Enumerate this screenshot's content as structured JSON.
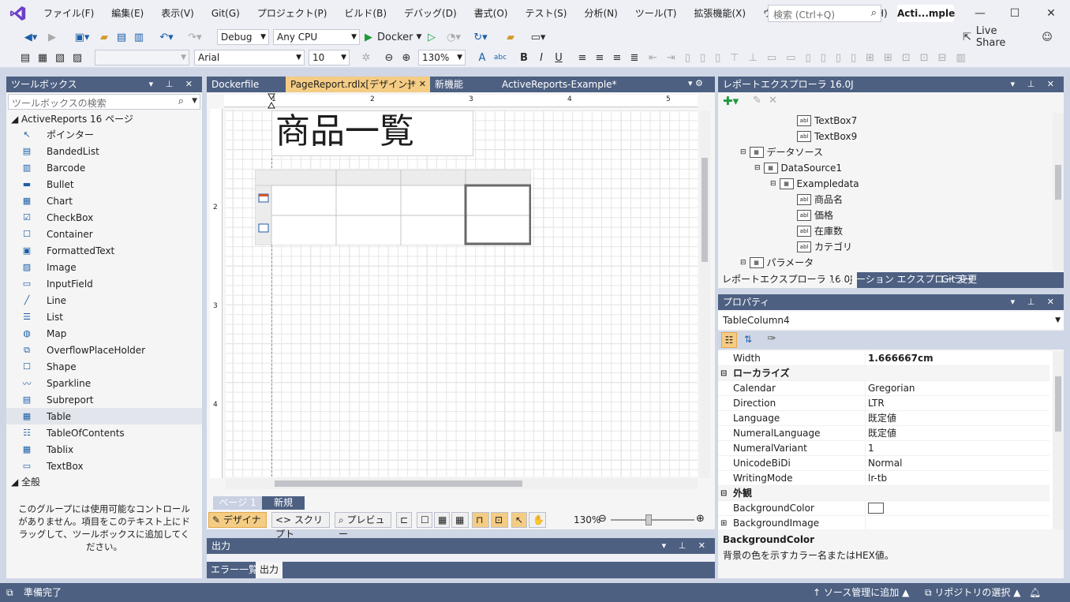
{
  "menu": {
    "items": [
      "ファイル(F)",
      "編集(E)",
      "表示(V)",
      "Git(G)",
      "プロジェクト(P)",
      "ビルド(B)",
      "デバッグ(D)",
      "書式(O)",
      "テスト(S)",
      "分析(N)",
      "ツール(T)",
      "拡張機能(X)",
      "ウィンドウ(W)",
      "ヘルプ(H)"
    ],
    "search_placeholder": "検索 (Ctrl+Q)",
    "solution_name": "Acti...mple"
  },
  "toolbar1": {
    "config": "Debug",
    "platform": "Any CPU",
    "run_label": "Docker",
    "live_share": "Live Share"
  },
  "toolbar2": {
    "style": "",
    "font": "Arial",
    "size": "10",
    "zoom": "130%"
  },
  "toolbox": {
    "title": "ツールボックス",
    "search_placeholder": "ツールボックスの検索",
    "group": "ActiveReports 16 ページ",
    "items": [
      "ポインター",
      "BandedList",
      "Barcode",
      "Bullet",
      "Chart",
      "CheckBox",
      "Container",
      "FormattedText",
      "Image",
      "InputField",
      "Line",
      "List",
      "Map",
      "OverflowPlaceHolder",
      "Shape",
      "Sparkline",
      "Subreport",
      "Table",
      "TableOfContents",
      "Tablix",
      "TextBox"
    ],
    "selected": "Table",
    "general_group": "全般",
    "empty_message": "このグループには使用可能なコントロールがありません。項目をこのテキスト上にドラッグして、ツールボックスに追加してください。"
  },
  "doc_tabs": [
    {
      "label": "Dockerfile",
      "active": false
    },
    {
      "label": "PageReport.rdlx[デザイン]*",
      "active": true
    },
    {
      "label": "新機能",
      "active": false
    },
    {
      "label": "ActiveReports-Example*",
      "active": false
    }
  ],
  "report": {
    "title_text": "商品一覧",
    "ruler_h": [
      "1",
      "2",
      "3",
      "4",
      "5"
    ],
    "ruler_v": [
      "2",
      "3",
      "4"
    ]
  },
  "page_tabs": {
    "page": "ページ 1",
    "new": "新規"
  },
  "designer_bar": {
    "designer": "デザイナ",
    "script": "スクリプト",
    "preview": "プレビュー",
    "zoom": "130%"
  },
  "output": {
    "title": "出力",
    "tab_errors": "エラー一覧",
    "tab_output": "出力"
  },
  "report_explorer": {
    "title": "レポートエクスプローラ 16.0J",
    "items": [
      {
        "label": "TextBox7",
        "level": 4
      },
      {
        "label": "TextBox9",
        "level": 4
      },
      {
        "label": "データソース",
        "level": 1
      },
      {
        "label": "DataSource1",
        "level": 2
      },
      {
        "label": "Exampledata",
        "level": 3
      },
      {
        "label": "商品名",
        "level": 4
      },
      {
        "label": "価格",
        "level": 4
      },
      {
        "label": "在庫数",
        "level": 4
      },
      {
        "label": "カテゴリ",
        "level": 4
      },
      {
        "label": "パラメータ",
        "level": 1
      }
    ],
    "tabs": [
      "レポートエクスプローラ 16.0J",
      "ソリューション エクスプローラー",
      "Git 変更"
    ]
  },
  "properties": {
    "title": "プロパティ",
    "object": "TableColumn4",
    "rows": [
      {
        "name": "Width",
        "value": "1.666667cm",
        "bold": true
      },
      {
        "name": "ローカライズ",
        "category": true
      },
      {
        "name": "Calendar",
        "value": "Gregorian"
      },
      {
        "name": "Direction",
        "value": "LTR"
      },
      {
        "name": "Language",
        "value": "既定値"
      },
      {
        "name": "NumeralLanguage",
        "value": "既定値"
      },
      {
        "name": "NumeralVariant",
        "value": "1"
      },
      {
        "name": "UnicodeBiDi",
        "value": "Normal"
      },
      {
        "name": "WritingMode",
        "value": "lr-tb"
      },
      {
        "name": "外観",
        "category": true
      },
      {
        "name": "BackgroundColor",
        "value": ""
      },
      {
        "name": "BackgroundImage",
        "value": ""
      }
    ],
    "desc_title": "BackgroundColor",
    "desc_text": "背景の色を示すカラー名またはHEX値。"
  },
  "status": {
    "left": "準備完了",
    "source_control": "ソース管理に追加",
    "repo": "リポジトリの選択"
  }
}
